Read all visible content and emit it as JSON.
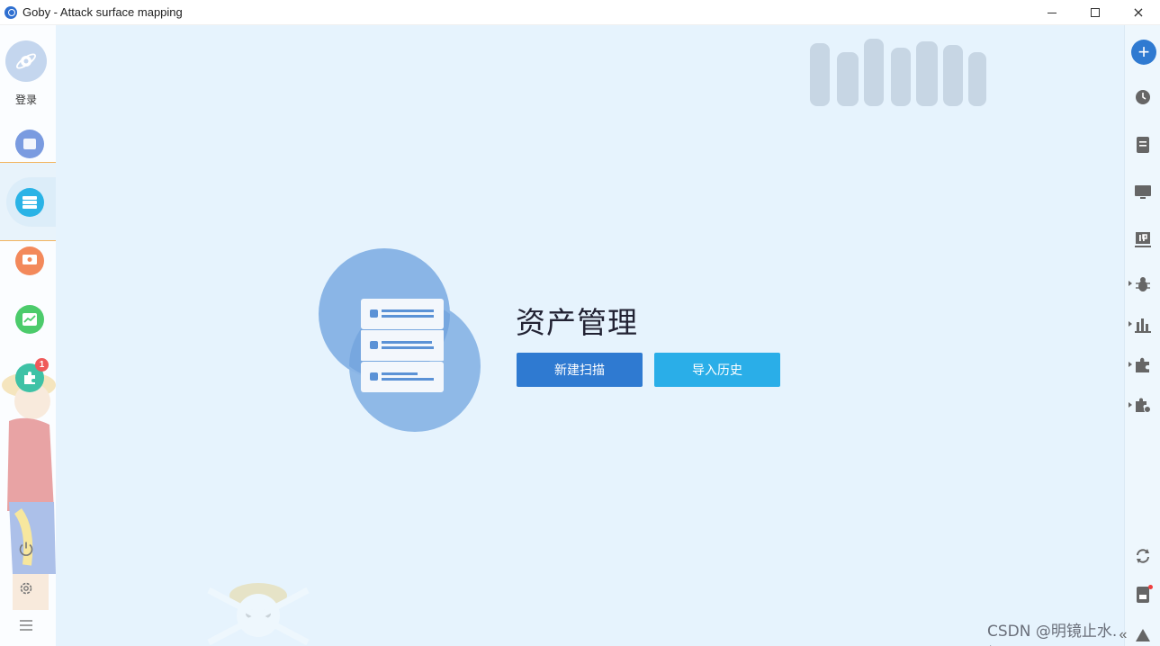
{
  "window": {
    "title": "Goby - Attack surface mapping",
    "controls": {
      "minimize": "minimize",
      "maximize": "maximize",
      "close": "×"
    }
  },
  "left_sidebar": {
    "login_label": "登录",
    "plugin_badge": "1",
    "colors": {
      "asset_blue": "#7a9be0",
      "asset_active": "#2ab3e6",
      "vuln_orange": "#f3895b",
      "report_green": "#4ccb6b",
      "plugin_teal": "#3ec2a6"
    }
  },
  "main": {
    "title": "资产管理",
    "new_scan_button": "新建扫描",
    "import_history_button": "导入历史",
    "watermark": "CSDN @明镜止水.樱"
  },
  "right_sidebar": {
    "add_button": "+",
    "collapse": "«"
  }
}
